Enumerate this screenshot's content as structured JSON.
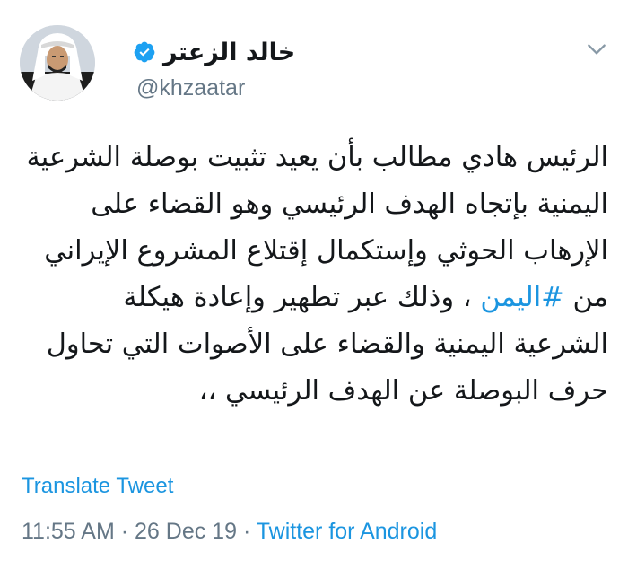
{
  "tweet": {
    "author": {
      "display_name": "خالد الزعتر",
      "handle": "@khzaatar",
      "verified": true
    },
    "text_before_hashtag": "الرئيس هادي مطالب بأن يعيد تثبيت بوصلة الشرعية اليمنية بإتجاه الهدف الرئيسي وهو القضاء على الإرهاب الحوثي وإستكمال إقتلاع المشروع الإيراني من ",
    "hashtag": "#اليمن",
    "text_after_hashtag": " ، وذلك عبر تطهير وإعادة هيكلة الشرعية اليمنية والقضاء على الأصوات التي تحاول حرف البوصلة عن الهدف الرئيسي ،،",
    "translate_label": "Translate Tweet",
    "time": "11:55 AM",
    "date": "26 Dec 19",
    "separator": "·",
    "source": "Twitter for Android"
  },
  "colors": {
    "link": "#1b95e0",
    "secondary_text": "#657786",
    "primary_text": "#14171a",
    "divider": "#e1e8ed"
  },
  "icons": {
    "verified": "verified-badge-icon",
    "menu": "chevron-down-icon"
  }
}
